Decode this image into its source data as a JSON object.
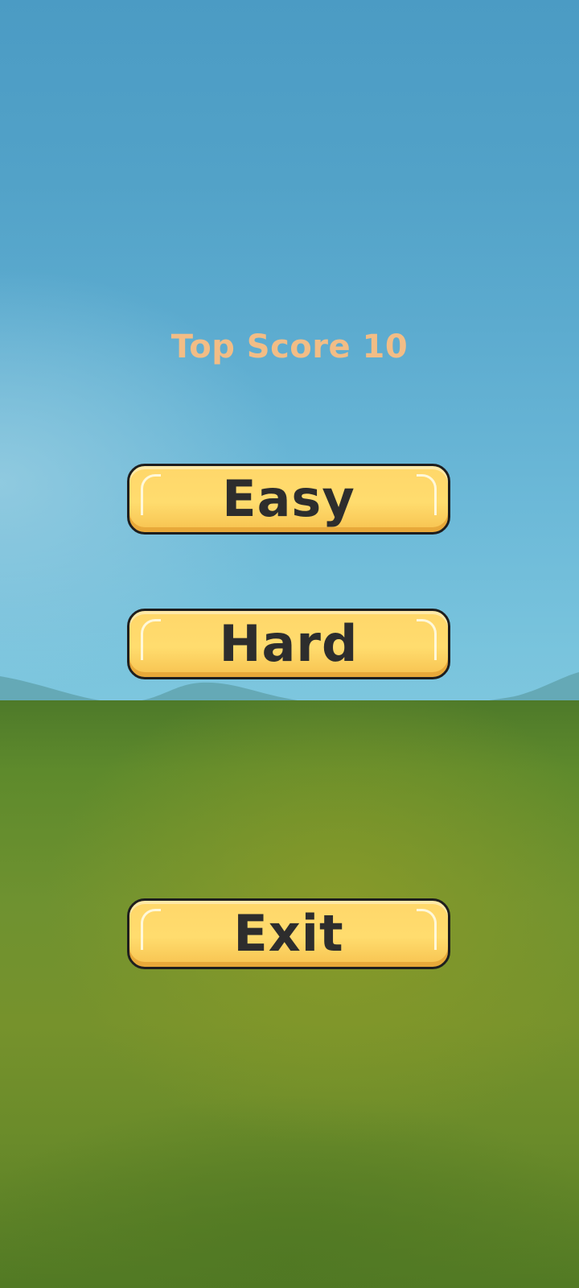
{
  "menu": {
    "top_score_text": "Top Score 10",
    "buttons": {
      "easy": "Easy",
      "hard": "Hard",
      "exit": "Exit"
    }
  },
  "colors": {
    "score_text": "#f2bd86",
    "button_fill": "#ffd76a",
    "button_border": "#1e1e1e",
    "button_text": "#2d2d2d",
    "sky": "#5cabcf",
    "grass": "#76922c"
  }
}
